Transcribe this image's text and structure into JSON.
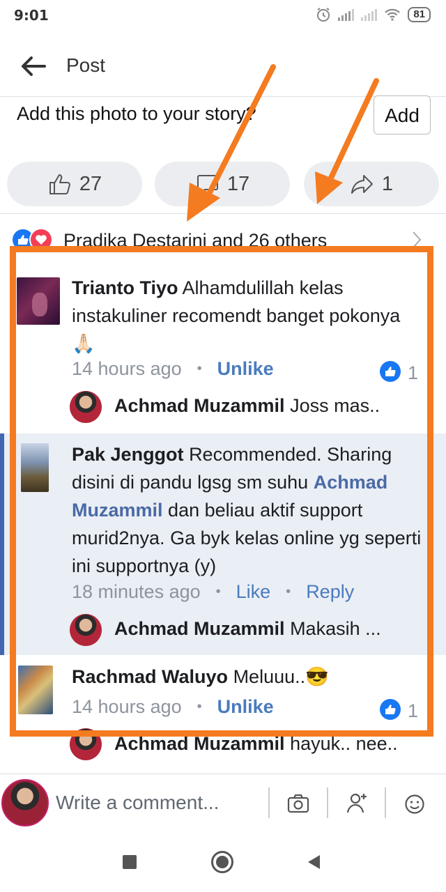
{
  "status_bar": {
    "time": "9:01",
    "battery": "81"
  },
  "header": {
    "title": "Post"
  },
  "story_prompt": {
    "question": "Add this photo to your story?",
    "add_label": "Add"
  },
  "actions": {
    "likes": "27",
    "comments": "17",
    "shares": "1"
  },
  "reactions": {
    "summary": "Pradika Destarini and 26 others"
  },
  "comments": [
    {
      "author": "Trianto Tiyo",
      "text": "Alhamdulillah kelas instakuliner recomendt banget pokonya 🙏🏻",
      "time": "14 hours ago",
      "action": "Unlike",
      "like_count": "1",
      "reply": {
        "author": "Achmad Muzammil",
        "text": "Joss mas.."
      }
    },
    {
      "author": "Pak Jenggot",
      "text_before": "Recommended. Sharing disini di pandu lgsg sm suhu",
      "mention": "Achmad Muzammil",
      "text_after": "dan beliau aktif support murid2nya. Ga byk kelas online yg seperti ini supportnya (y)",
      "time": "18 minutes ago",
      "action": "Like",
      "reply_action": "Reply",
      "reply": {
        "author": "Achmad Muzammil",
        "text": "Makasih ..."
      }
    },
    {
      "author": "Rachmad Waluyo",
      "text": "Meluuu..😎",
      "time": "14 hours ago",
      "action": "Unlike",
      "like_count": "1",
      "reply": {
        "author": "Achmad Muzammil",
        "text": "hayuk.. nee.."
      }
    }
  ],
  "composer": {
    "placeholder": "Write a comment..."
  },
  "colors": {
    "accent": "#1877f2",
    "annotation": "#f47b20",
    "highlight": "#eaeef5"
  }
}
